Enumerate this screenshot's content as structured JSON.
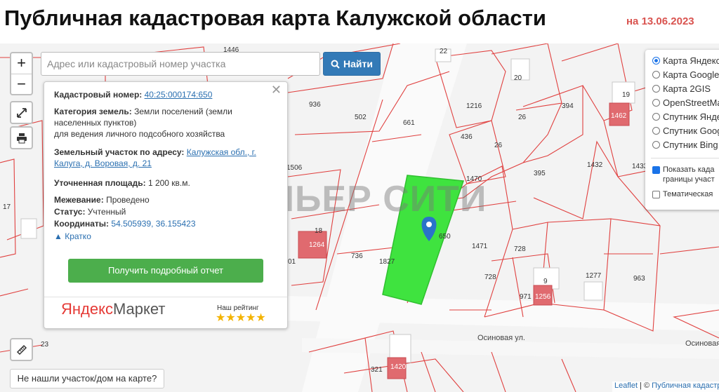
{
  "header": {
    "title": "Публичная кадастровая карта Калужской области",
    "date": "на 13.06.2023"
  },
  "search": {
    "placeholder": "Адрес или кадастровый номер участка",
    "button_label": "Найти"
  },
  "zoom": {
    "in": "+",
    "out": "−"
  },
  "info_card": {
    "cadastral_label": "Кадастровый номер:",
    "cadastral_value": "40:25:000174:650",
    "category_label": "Категория земель:",
    "category_value": "Земли поселений (земли населенных пунктов)",
    "usage_value": "для ведения личного подсобного хозяйства",
    "address_label": "Земельный участок по адресу:",
    "address_value": "Калужская обл., г. Калуга, д. Воровая, д. 21",
    "area_label": "Уточненная площадь:",
    "area_value": "1 200 кв.м.",
    "survey_label": "Межевание:",
    "survey_value": "Проведено",
    "status_label": "Статус:",
    "status_value": "Учтенный",
    "coords_label": "Координаты:",
    "coords_value": "54.505939, 36.155423",
    "collapse_label": "Кратко",
    "report_button": "Получить подробный отчет",
    "ad_brand_ya": "Яндекс",
    "ad_brand_rest": "Маркет",
    "rating_label": "Наш рейтинг",
    "stars": "★★★★★"
  },
  "layers": {
    "base": [
      {
        "label": "Карта Яндекс",
        "checked": true
      },
      {
        "label": "Карта Google",
        "checked": false
      },
      {
        "label": "Карта 2GIS",
        "checked": false
      },
      {
        "label": "OpenStreetMap",
        "checked": false
      },
      {
        "label": "Спутник Яндекс",
        "checked": false
      },
      {
        "label": "Спутник Google",
        "checked": false
      },
      {
        "label": "Спутник Bing",
        "checked": false
      }
    ],
    "overlay_cadastral_1": "Показать када",
    "overlay_cadastral_2": "границы участ",
    "overlay_thematic": "Тематическая"
  },
  "watermark": "ПРЕМЬЕР СИТИ",
  "plot_numbers": {
    "p1446": "1446",
    "p22": "22",
    "p20": "20",
    "p19": "19",
    "p936": "936",
    "p502": "502",
    "p661": "661",
    "p1216": "1216",
    "p26a": "26",
    "p394": "394",
    "p1462": "1462",
    "p436": "436",
    "p26b": "26",
    "p1470": "1470",
    "p395": "395",
    "p1432": "1432",
    "p1433": "1433",
    "p1506": "1506",
    "p17": "17",
    "p18": "18",
    "p1264": "1264",
    "p736": "736",
    "p1827": "1827",
    "p650": "650",
    "p1471": "1471",
    "p728a": "728",
    "p728b": "728",
    "p1277": "1277",
    "p963": "963",
    "p9": "9",
    "p971": "971",
    "p1256": "1256",
    "p23": "23",
    "p321": "321",
    "p1420": "1420",
    "p01": "01"
  },
  "streets": {
    "osinovaya_1": "Осиновая ул.",
    "osinovaya_2": "Осиновая"
  },
  "not_found_button": "Не нашли участок/дом на карте?",
  "attribution": {
    "leaflet": "Leaflet",
    "sep": " | © ",
    "source": "Публичная кадастр"
  },
  "colors": {
    "boundary": "#e0403f",
    "selected_plot": "#3fe33f",
    "accent": "#337ab7",
    "report": "#4cae4c"
  }
}
